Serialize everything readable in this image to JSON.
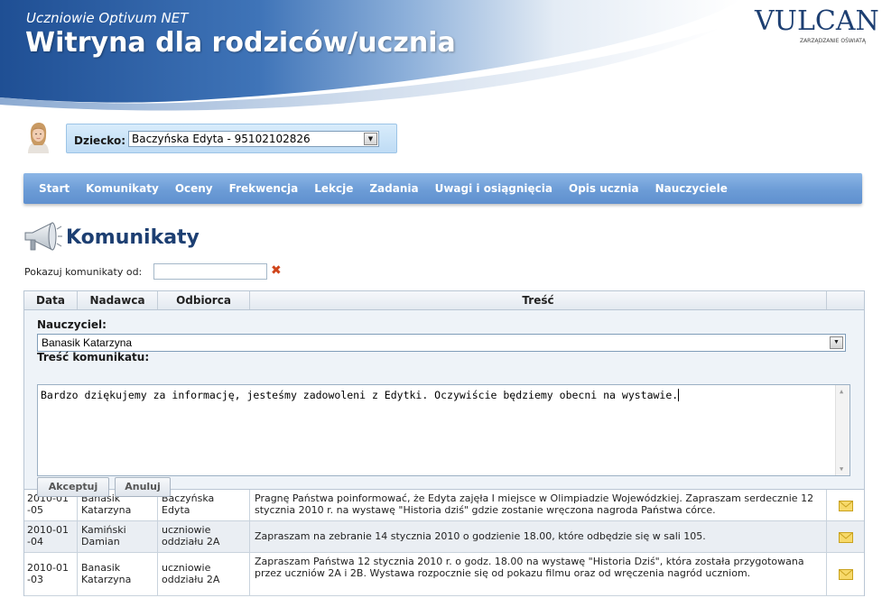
{
  "header": {
    "subtitle": "Uczniowie Optivum NET",
    "title": "Witryna dla rodziców/ucznia",
    "logo_text": "VULCAN",
    "logo_tagline": "ZARZĄDZANIE OŚWIATĄ"
  },
  "child": {
    "label": "Dziecko:",
    "selected": "Baczyńska Edyta - 95102102826"
  },
  "nav": {
    "items": [
      "Start",
      "Komunikaty",
      "Oceny",
      "Frekwencja",
      "Lekcje",
      "Zadania",
      "Uwagi i osiągnięcia",
      "Opis ucznia",
      "Nauczyciele"
    ]
  },
  "page": {
    "title": "Komunikaty",
    "filter_label": "Pokazuj komunikaty od:",
    "filter_value": ""
  },
  "table": {
    "headers": [
      "Data",
      "Nadawca",
      "Odbiorca",
      "Treść",
      ""
    ],
    "editor": {
      "teacher_label": "Nauczyciel:",
      "teacher_selected": "Banasik Katarzyna",
      "message_label": "Treść komunikatu:",
      "message_text": "Bardzo dziękujemy za informację, jesteśmy zadowoleni z Edytki. Oczywiście będziemy obecni na wystawie.",
      "accept_label": "Akceptuj",
      "cancel_label": "Anuluj"
    },
    "rows": [
      {
        "date": "2010-01\n-05",
        "sender": "Banasik\nKatarzyna",
        "recipient": "Baczyńska\nEdyta",
        "content": "Pragnę Państwa poinformować, że Edyta zajęła I miejsce w Olimpiadzie Wojewódzkiej. Zapraszam serdecznie 12 stycznia 2010 r. na wystawę \"Historia dziś\" gdzie zostanie wręczona nagroda Państwa córce."
      },
      {
        "date": "2010-01\n-04",
        "sender": "Kamiński\nDamian",
        "recipient": "uczniowie\noddziału 2A",
        "content": "Zapraszam na zebranie 14 stycznia 2010 o godzienie 18.00, które odbędzie się w sali 105."
      },
      {
        "date": "2010-01\n-03",
        "sender": "Banasik\nKatarzyna",
        "recipient": "uczniowie\noddziału 2A",
        "content": "Zapraszam Państwa 12 stycznia 2010 r. o godz. 18.00 na wystawę \"Historia Dziś\", która została przygotowana przez uczniów 2A i 2B. Wystawa rozpocznie się od pokazu filmu oraz od wręczenia nagród uczniom."
      }
    ]
  },
  "icons": {
    "envelope": "envelope-icon",
    "clear": "clear-filter-icon",
    "megaphone": "megaphone-icon",
    "dropdown": "chevron-down-icon"
  },
  "colors": {
    "nav_bar": "#6c9cd6",
    "title_blue": "#1d3f72",
    "banner_blue": "#2a5aa0"
  }
}
